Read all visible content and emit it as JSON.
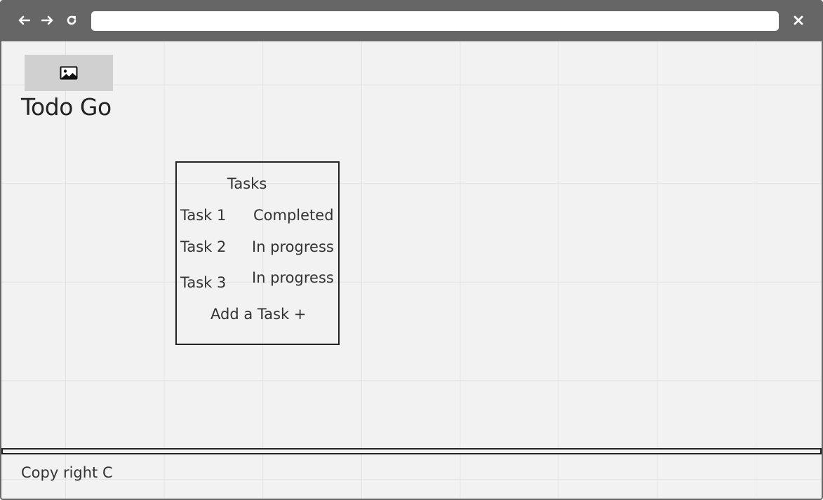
{
  "browser": {
    "address_value": "",
    "icons": {
      "back": "arrow-left-icon",
      "forward": "arrow-right-icon",
      "reload": "reload-icon",
      "close": "close-icon"
    }
  },
  "header": {
    "logo_icon": "image-icon",
    "title": "Todo Go"
  },
  "tasks_panel": {
    "heading": "Tasks",
    "tasks": [
      {
        "name": "Task 1",
        "status": "Completed"
      },
      {
        "name": "Task 2",
        "status": "In progress"
      },
      {
        "name": "Task 3",
        "status": "In progress"
      }
    ],
    "add_label": "Add a Task +"
  },
  "footer": {
    "text": "Copy right C"
  },
  "colors": {
    "chrome": "#666666",
    "canvas": "#f2f2f2",
    "placeholder": "#d0d0d0",
    "ink": "#222222"
  }
}
